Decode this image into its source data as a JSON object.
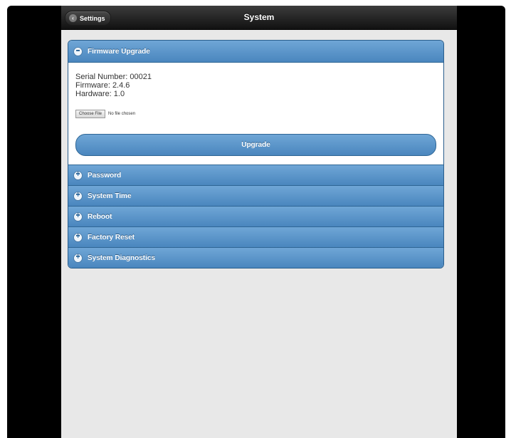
{
  "header": {
    "back_label": "Settings",
    "title": "System"
  },
  "firmware": {
    "title": "Firmware Upgrade",
    "serial": "Serial Number: 00021",
    "firmware": "Firmware: 2.4.6",
    "hardware": "Hardware: 1.0",
    "choose_file": "Choose File",
    "no_file": "No file chosen",
    "upgrade": "Upgrade"
  },
  "sections": [
    {
      "label": "Password"
    },
    {
      "label": "System Time"
    },
    {
      "label": "Reboot"
    },
    {
      "label": "Factory Reset"
    },
    {
      "label": "System Diagnostics"
    }
  ],
  "icons": {
    "expanded": "minus-circle-icon",
    "collapsed": "plus-circle-icon",
    "back": "chevron-left-icon"
  },
  "colors": {
    "accent": "#4a86be",
    "topbar": "#1e1e1e"
  }
}
